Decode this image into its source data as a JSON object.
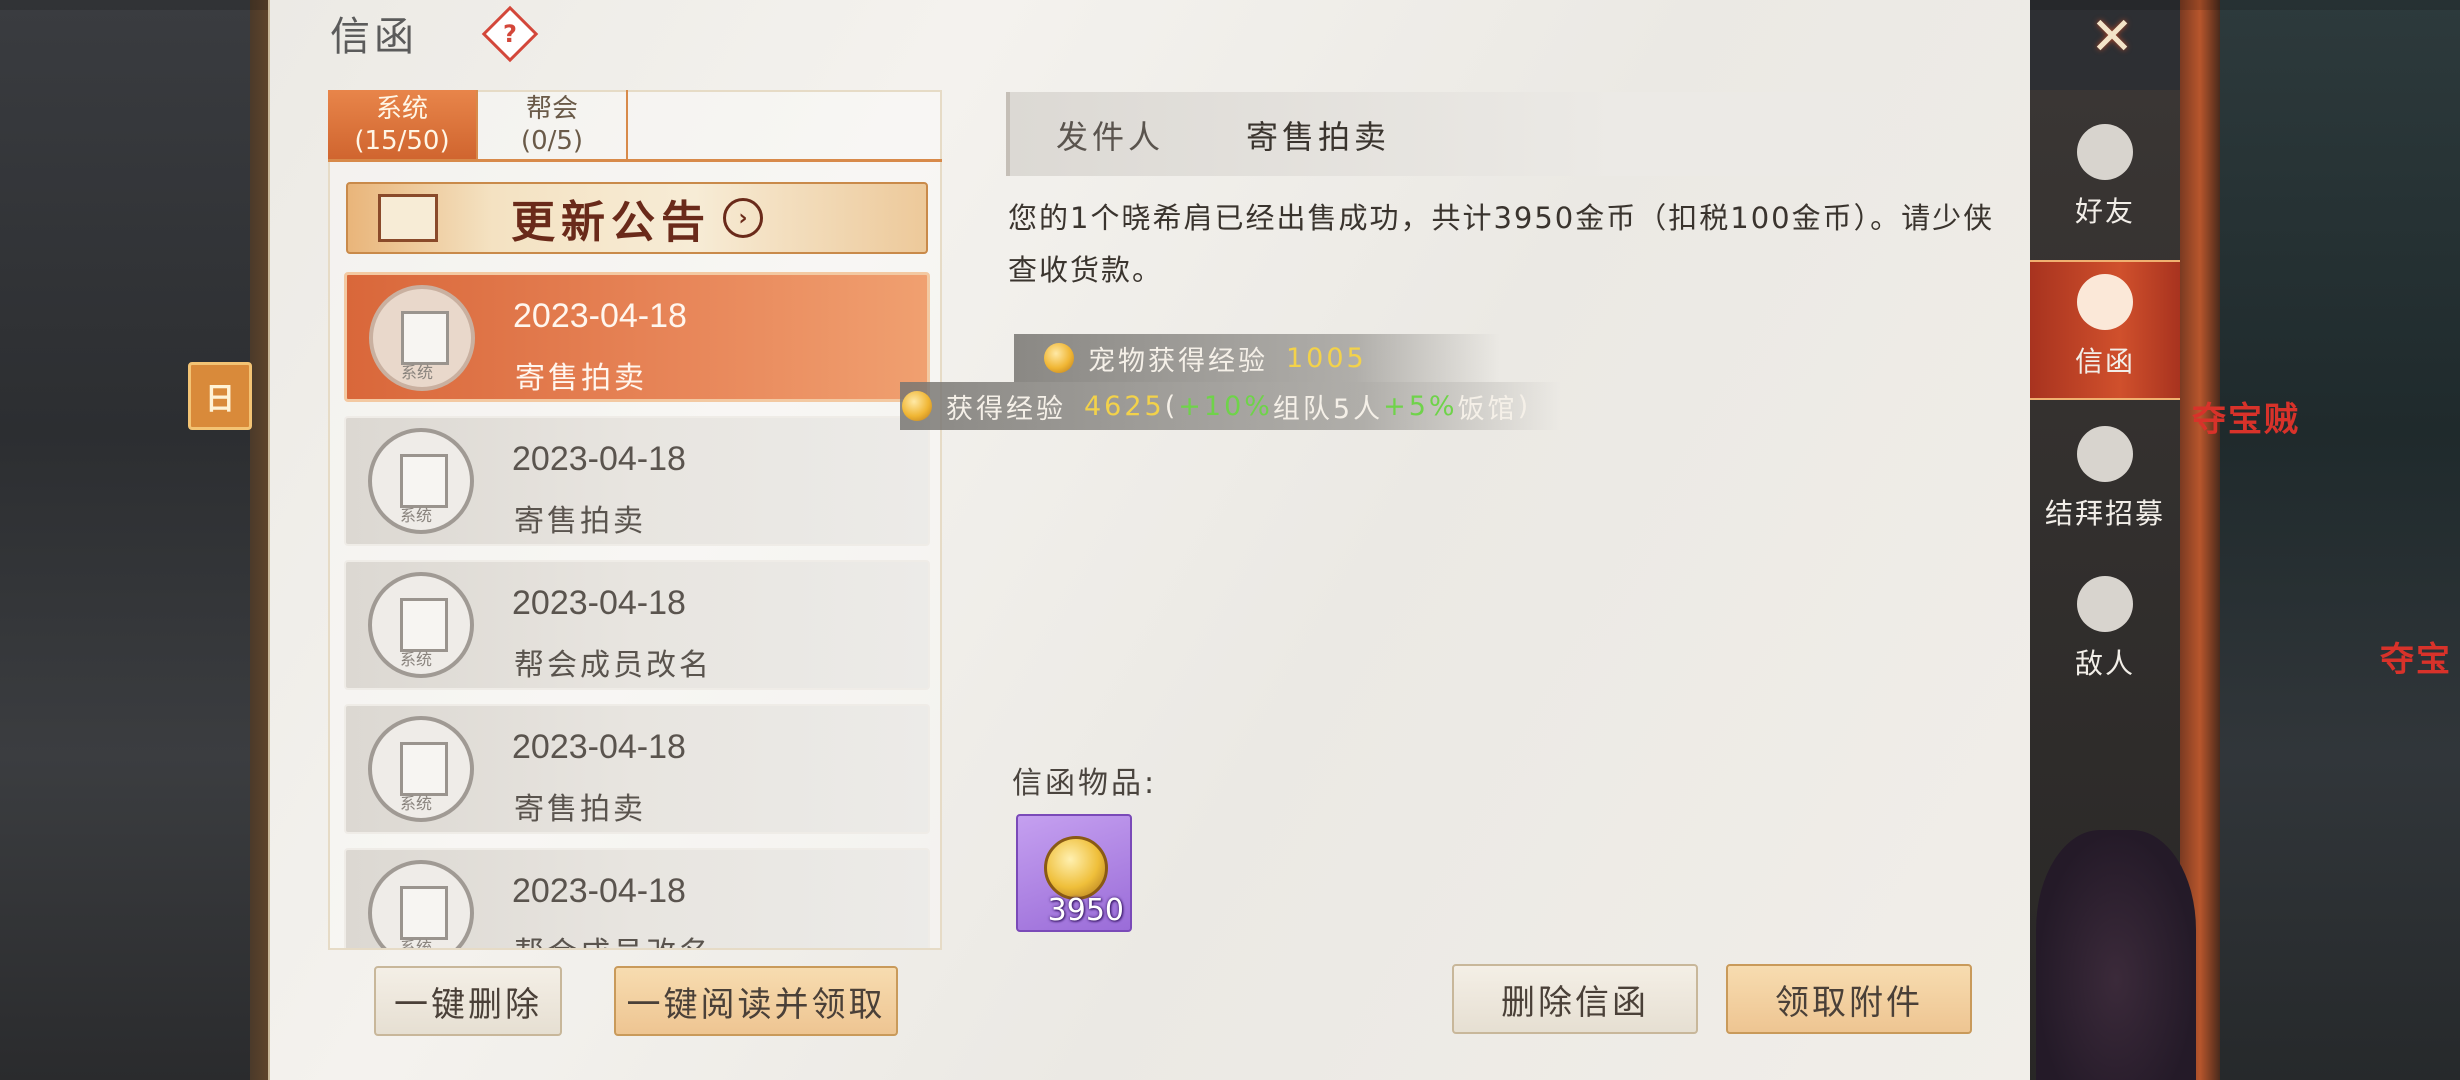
{
  "window": {
    "title": "信函",
    "help_label": "?",
    "close_label": "✕"
  },
  "world": {
    "left_badge": "日",
    "enemy_names": [
      "夺宝贼",
      "夺宝"
    ]
  },
  "tabs": [
    {
      "label": "系统",
      "count": "(15/50)",
      "active": true
    },
    {
      "label": "帮会",
      "count": "(0/5)",
      "active": false
    }
  ],
  "announcement": {
    "label": "更新公告",
    "arrow": "›"
  },
  "mail_list": [
    {
      "date": "2023-04-18",
      "subject": "寄售拍卖",
      "tag": "系统",
      "active": true
    },
    {
      "date": "2023-04-18",
      "subject": "寄售拍卖",
      "tag": "系统",
      "active": false
    },
    {
      "date": "2023-04-18",
      "subject": "帮会成员改名",
      "tag": "系统",
      "active": false
    },
    {
      "date": "2023-04-18",
      "subject": "寄售拍卖",
      "tag": "系统",
      "active": false
    },
    {
      "date": "2023-04-18",
      "subject": "帮会成员改名",
      "tag": "系统",
      "active": false
    }
  ],
  "list_buttons": {
    "delete_all": "一键删除",
    "read_all": "一键阅读并领取"
  },
  "detail": {
    "sender_label": "发件人",
    "sender_value": "寄售拍卖",
    "body": "您的1个晓希肩已经出售成功，共计3950金币（扣税100金币）。请少侠查收货款。",
    "pet_exp": {
      "label": "宠物获得经验",
      "value": "1005"
    },
    "exp": {
      "label": "获得经验",
      "value": "4625",
      "open": "(",
      "bonus_team": "+10%",
      "team_text": "组队5人",
      "bonus_inn": "+5%",
      "inn_text": "饭馆",
      "close": ")"
    },
    "items_label": "信函物品:",
    "item": {
      "icon": "gold-coin-icon",
      "count": "3950"
    },
    "delete_button": "删除信函",
    "claim_button": "领取附件"
  },
  "side_nav": [
    {
      "label": "好友",
      "icon": "friends-icon",
      "active": false
    },
    {
      "label": "信函",
      "icon": "mail-icon",
      "active": true
    },
    {
      "label": "结拜招募",
      "icon": "sworn-recruit-icon",
      "active": false
    },
    {
      "label": "敌人",
      "icon": "enemy-icon",
      "active": false
    }
  ],
  "colors": {
    "accent": "#d9673a",
    "exp_value": "#f3d24a",
    "exp_bonus": "#6fd34a",
    "item_rarity": "#9a6cd8"
  }
}
